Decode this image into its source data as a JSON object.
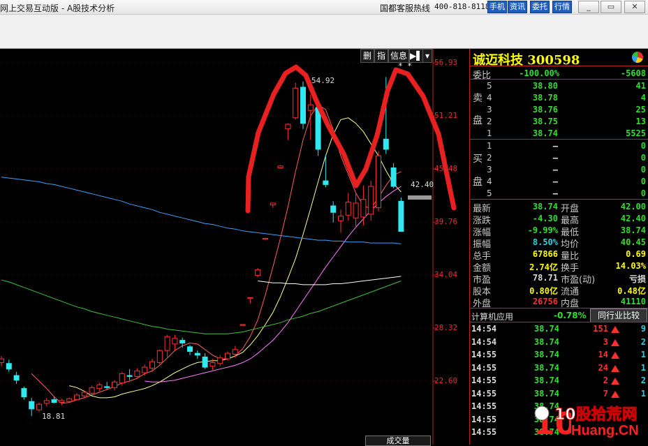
{
  "window": {
    "title": "网上交易互动版 - A股技术分析",
    "hotline_label": "国都客服热线",
    "hotline_number": "400-818-8118",
    "buttons": [
      "手机",
      "资讯",
      "委托",
      "行情"
    ],
    "controls": [
      "_",
      "▭",
      "✕"
    ]
  },
  "chart": {
    "toolbar": [
      "删",
      "指",
      "信息",
      "▶▌",
      "▾"
    ],
    "price_ticks": [
      "56.93",
      "51.21",
      "45.48",
      "39.76",
      "34.04",
      "28.32",
      "22.60"
    ],
    "high_label": "54.92",
    "low_label": "18.81",
    "last_label": "42.40",
    "star_marks": "* *",
    "volume_tab": "成交量",
    "annotation_color": "#e82020",
    "colors": {
      "up": "#ff3030",
      "down": "#30e8f0",
      "ma5": "#ff6060",
      "ma10": "#ffff90",
      "ma20": "#ff80ff",
      "ma60": "#40c040",
      "ma120": "#ffffff",
      "ma250": "#40a0ff"
    }
  },
  "chart_data": {
    "type": "candlestick",
    "ylim": [
      18,
      57
    ],
    "y_ticks": [
      56.93,
      51.21,
      45.48,
      39.76,
      34.04,
      28.32,
      22.6
    ],
    "candles": [
      [
        24.6,
        25.3,
        24.2,
        25.0
      ],
      [
        24.5,
        24.9,
        23.6,
        23.9
      ],
      [
        23.2,
        23.6,
        22.3,
        22.7
      ],
      [
        21.8,
        22.0,
        20.6,
        20.9
      ],
      [
        20.4,
        20.8,
        18.81,
        19.6
      ],
      [
        19.5,
        20.3,
        19.3,
        20.1
      ],
      [
        20.2,
        20.8,
        19.9,
        20.5
      ],
      [
        20.6,
        20.9,
        20.2,
        20.3
      ],
      [
        20.3,
        20.7,
        20.0,
        20.5
      ],
      [
        20.4,
        20.8,
        20.3,
        20.7
      ],
      [
        20.6,
        21.3,
        20.5,
        21.1
      ],
      [
        21.0,
        21.6,
        20.8,
        21.4
      ],
      [
        21.3,
        22.1,
        21.1,
        21.9
      ],
      [
        21.8,
        22.4,
        21.5,
        22.2
      ],
      [
        22.0,
        22.5,
        21.7,
        21.9
      ],
      [
        21.9,
        22.7,
        21.6,
        22.5
      ],
      [
        22.4,
        23.6,
        22.1,
        23.4
      ],
      [
        23.2,
        23.9,
        22.7,
        23.1
      ],
      [
        23.1,
        24.0,
        22.9,
        23.7
      ],
      [
        23.5,
        24.4,
        23.2,
        24.1
      ],
      [
        24.0,
        25.0,
        23.6,
        24.7
      ],
      [
        24.6,
        26.0,
        24.4,
        25.9
      ],
      [
        25.9,
        27.6,
        25.2,
        27.4
      ],
      [
        26.6,
        27.6,
        25.9,
        27.2
      ],
      [
        27.0,
        27.3,
        26.2,
        26.7
      ],
      [
        26.3,
        26.5,
        25.4,
        25.8
      ],
      [
        25.6,
        25.9,
        25.0,
        25.4
      ],
      [
        25.2,
        25.6,
        23.9,
        24.1
      ],
      [
        24.2,
        25.0,
        23.8,
        24.6
      ],
      [
        24.5,
        25.4,
        24.2,
        25.1
      ],
      [
        25.0,
        25.8,
        24.8,
        25.6
      ],
      [
        25.5,
        26.4,
        25.1,
        26.0
      ],
      [
        28.7,
        28.7,
        28.7,
        28.7
      ],
      [
        31.5,
        31.6,
        31.0,
        31.6
      ],
      [
        34.0,
        34.8,
        33.8,
        34.6
      ],
      [
        37.9,
        38.0,
        37.8,
        38.0
      ],
      [
        41.6,
        41.8,
        41.3,
        41.8
      ],
      [
        45.6,
        45.9,
        45.5,
        45.8
      ],
      [
        49.8,
        50.4,
        48.6,
        50.3
      ],
      [
        51.0,
        54.8,
        50.8,
        54.2
      ],
      [
        54.3,
        54.92,
        49.8,
        50.4
      ],
      [
        51.8,
        53.5,
        48.6,
        52.4
      ],
      [
        52.1,
        52.4,
        46.9,
        47.6
      ],
      [
        44.2,
        47.0,
        43.5,
        43.8
      ],
      [
        41.5,
        42.0,
        39.7,
        40.8
      ],
      [
        39.9,
        41.1,
        38.6,
        40.4
      ],
      [
        40.5,
        42.9,
        39.9,
        41.9
      ],
      [
        40.2,
        42.8,
        39.1,
        41.8
      ],
      [
        40.3,
        43.7,
        39.4,
        42.2
      ],
      [
        40.6,
        44.2,
        39.9,
        43.6
      ],
      [
        41.3,
        47.4,
        40.9,
        46.9
      ],
      [
        48.7,
        55.4,
        47.1,
        47.6
      ],
      [
        45.6,
        46.1,
        43.4,
        43.6
      ],
      [
        42.0,
        42.4,
        38.74,
        38.74
      ]
    ],
    "series": [
      {
        "name": "MA5",
        "values": [
          null,
          null,
          null,
          null,
          23.4,
          22.6,
          21.8,
          20.9,
          20.2,
          20.3,
          20.6,
          20.8,
          21.1,
          21.4,
          21.7,
          22.0,
          22.4,
          22.6,
          22.9,
          23.4,
          23.7,
          24.3,
          25.1,
          25.9,
          26.4,
          26.7,
          26.6,
          26.0,
          25.4,
          25.0,
          25.0,
          25.3,
          26.1,
          27.4,
          29.2,
          31.9,
          34.9,
          38.0,
          41.4,
          45.2,
          48.6,
          51.2,
          52.4,
          51.9,
          49.7,
          46.9,
          44.9,
          42.9,
          41.5,
          41.2,
          42.4,
          43.7,
          44.8,
          45.2
        ]
      },
      {
        "name": "MA10",
        "values": [
          null,
          null,
          null,
          null,
          null,
          null,
          null,
          null,
          null,
          22.1,
          21.9,
          21.5,
          21.0,
          20.8,
          20.8,
          20.9,
          21.2,
          21.4,
          21.6,
          21.8,
          22.1,
          22.5,
          23.0,
          23.5,
          23.9,
          24.3,
          24.6,
          24.7,
          24.8,
          24.8,
          25.0,
          25.3,
          25.7,
          26.5,
          27.5,
          28.7,
          30.0,
          31.7,
          33.7,
          35.8,
          38.4,
          41.2,
          44.1,
          46.9,
          49.2,
          50.8,
          51.0,
          50.4,
          49.5,
          48.2,
          46.9,
          45.3,
          43.9,
          43.0
        ]
      },
      {
        "name": "MA20",
        "values": [
          null,
          null,
          null,
          null,
          null,
          null,
          null,
          null,
          null,
          null,
          null,
          null,
          null,
          null,
          null,
          null,
          null,
          null,
          null,
          22.6,
          22.5,
          22.5,
          22.6,
          22.7,
          22.9,
          23.1,
          23.3,
          23.5,
          23.7,
          23.9,
          24.1,
          24.3,
          24.6,
          25.0,
          25.6,
          26.3,
          27.0,
          27.9,
          28.9,
          30.1,
          31.3,
          32.5,
          33.7,
          34.9,
          36.0,
          37.1,
          38.2,
          39.2,
          40.1,
          41.0,
          41.8,
          42.5,
          43.1,
          43.6
        ]
      },
      {
        "name": "MA60",
        "values": [
          33.5,
          33.3,
          33.0,
          32.7,
          32.4,
          32.1,
          31.8,
          31.5,
          31.2,
          30.9,
          30.6,
          30.4,
          30.1,
          29.9,
          29.7,
          29.5,
          29.3,
          29.1,
          28.9,
          28.7,
          28.5,
          28.4,
          28.2,
          28.1,
          28.0,
          27.9,
          27.8,
          27.7,
          27.7,
          27.7,
          27.7,
          27.8,
          27.9,
          28.1,
          28.3,
          28.5,
          28.7,
          28.9,
          29.2,
          29.4,
          29.6,
          29.9,
          30.1,
          30.4,
          30.7,
          31.0,
          31.3,
          31.6,
          31.9,
          32.2,
          32.5,
          32.8,
          33.1,
          33.4
        ]
      },
      {
        "name": "MA120",
        "values": [
          null,
          null,
          null,
          null,
          null,
          null,
          null,
          null,
          null,
          null,
          null,
          null,
          null,
          null,
          null,
          null,
          null,
          null,
          null,
          null,
          null,
          null,
          null,
          null,
          null,
          null,
          null,
          null,
          null,
          null,
          null,
          null,
          null,
          null,
          33.4,
          33.3,
          33.2,
          33.2,
          33.1,
          33.1,
          33.0,
          33.0,
          33.0,
          33.0,
          33.1,
          33.1,
          33.2,
          33.3,
          33.4,
          33.5,
          33.6,
          33.7,
          33.8,
          33.9
        ]
      },
      {
        "name": "MA250",
        "values": [
          44.6,
          44.5,
          44.4,
          44.3,
          44.2,
          44.1,
          43.9,
          43.8,
          43.6,
          43.4,
          43.2,
          43.0,
          42.8,
          42.6,
          42.4,
          42.2,
          42.0,
          41.7,
          41.5,
          41.3,
          41.1,
          40.8,
          40.6,
          40.4,
          40.2,
          40.0,
          39.8,
          39.6,
          39.5,
          39.3,
          39.1,
          39.0,
          38.8,
          38.7,
          38.6,
          38.5,
          38.4,
          38.3,
          38.2,
          38.1,
          38.0,
          37.9,
          37.8,
          37.8,
          37.7,
          37.7,
          37.6,
          37.6,
          37.6,
          37.5,
          37.5,
          37.5,
          37.5,
          37.4
        ]
      }
    ]
  },
  "quote": {
    "stock_name": "诚迈科技 300598",
    "weibi_label": "委比",
    "weibi_pct": "-100.00%",
    "weibi_diff": "-5608",
    "sell_label": [
      "卖",
      "盘"
    ],
    "buy_label": [
      "买",
      "盘"
    ],
    "sell": [
      {
        "lvl": "5",
        "price": "38.80",
        "vol": "41"
      },
      {
        "lvl": "4",
        "price": "38.78",
        "vol": "4"
      },
      {
        "lvl": "3",
        "price": "38.76",
        "vol": "25"
      },
      {
        "lvl": "2",
        "price": "38.75",
        "vol": "13"
      },
      {
        "lvl": "1",
        "price": "38.74",
        "vol": "5525"
      }
    ],
    "buy": [
      {
        "lvl": "1",
        "price": "—",
        "vol": "0"
      },
      {
        "lvl": "2",
        "price": "—",
        "vol": "0"
      },
      {
        "lvl": "3",
        "price": "—",
        "vol": "0"
      },
      {
        "lvl": "4",
        "price": "—",
        "vol": "0"
      },
      {
        "lvl": "5",
        "price": "—",
        "vol": "0"
      }
    ],
    "stats": [
      {
        "l1": "最新",
        "v1": "38.74",
        "c1": "g",
        "l2": "开盘",
        "v2": "42.00",
        "c2": "g"
      },
      {
        "l1": "涨跌",
        "v1": "-4.30",
        "c1": "g",
        "l2": "最高",
        "v2": "42.40",
        "c2": "g"
      },
      {
        "l1": "涨幅",
        "v1": "-9.99%",
        "c1": "g",
        "l2": "最低",
        "v2": "38.74",
        "c2": "g"
      },
      {
        "l1": "振幅",
        "v1": "8.50%",
        "c1": "c",
        "l2": "均价",
        "v2": "40.45",
        "c2": "g"
      },
      {
        "l1": "总手",
        "v1": "67866",
        "c1": "y",
        "l2": "量比",
        "v2": "0.69",
        "c2": "y"
      },
      {
        "l1": "金额",
        "v1": "2.74亿",
        "c1": "y",
        "l2": "换手",
        "v2": "14.03%",
        "c2": "y"
      },
      {
        "l1": "市盈",
        "v1": "78.71",
        "c1": "w",
        "l2": "市盈(动)",
        "v2": "亏损",
        "c2": "w"
      },
      {
        "l1": "股本",
        "v1": "0.80亿",
        "c1": "y",
        "l2": "流通",
        "v2": "0.48亿",
        "c2": "y"
      },
      {
        "l1": "外盘",
        "v1": "26756",
        "c1": "r",
        "l2": "内盘",
        "v2": "41110",
        "c2": "g"
      }
    ],
    "sector_name": "计算机应用",
    "sector_change": "-0.78%",
    "compare_button": "同行业比较",
    "ticks": [
      {
        "time": "14:54",
        "price": "38.74",
        "vol": "151",
        "num": "9"
      },
      {
        "time": "14:54",
        "price": "38.74",
        "vol": "3",
        "num": "2"
      },
      {
        "time": "14:55",
        "price": "38.74",
        "vol": "14",
        "num": "1"
      },
      {
        "time": "14:55",
        "price": "38.74",
        "vol": "24",
        "num": "1"
      },
      {
        "time": "14:55",
        "price": "38.74",
        "vol": "2",
        "num": "2"
      },
      {
        "time": "14:55",
        "price": "38.74",
        "vol": "7",
        "num": "1"
      },
      {
        "time": "14:55",
        "price": "38.74",
        "vol": "",
        "num": ""
      },
      {
        "time": "14:55",
        "price": "38.74",
        "vol": "",
        "num": ""
      },
      {
        "time": "14:55",
        "price": "38.74",
        "vol": "",
        "num": ""
      }
    ]
  },
  "watermark": {
    "top": "10股拾荒网",
    "bottom": "Huang.CN"
  }
}
